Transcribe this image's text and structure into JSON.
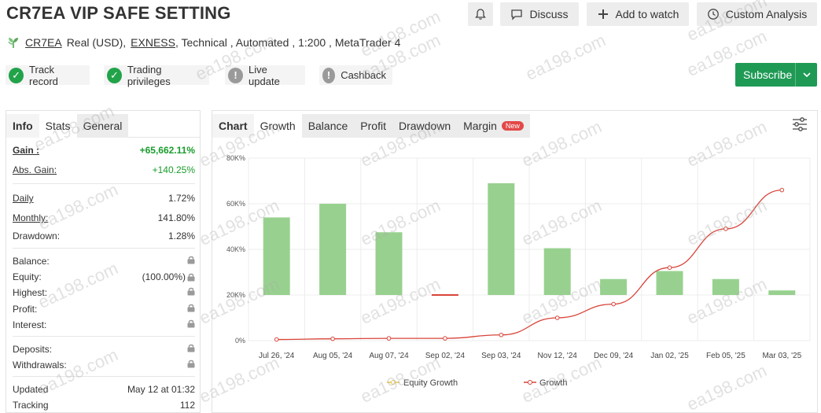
{
  "header": {
    "title": "CR7EA VIP SAFE SETTING",
    "account_name": "CR7EA",
    "account_type": "Real (USD),",
    "broker": "EXNESS",
    "details": ", Technical , Automated , 1:200 , MetaTrader 4"
  },
  "toolbar": {
    "discuss_label": "Discuss",
    "add_watch_label": "Add to watch",
    "custom_analysis_label": "Custom Analysis",
    "subscribe_label": "Subscribe"
  },
  "badges": {
    "track_record": "Track record",
    "trading_privileges": "Trading privileges",
    "live_update": "Live update",
    "cashback": "Cashback"
  },
  "left_tabs": {
    "info": "Info",
    "stats": "Stats",
    "general": "General"
  },
  "stats": {
    "gain_label": "Gain :",
    "gain_value": "+65,662.11%",
    "abs_gain_label": "Abs. Gain:",
    "abs_gain_value": "+140.25%",
    "daily_label": "Daily",
    "daily_value": "1.72%",
    "monthly_label": "Monthly:",
    "monthly_value": "141.80%",
    "drawdown_label": "Drawdown:",
    "drawdown_value": "1.28%",
    "balance_label": "Balance:",
    "equity_label": "Equity:",
    "equity_value": "(100.00%)",
    "highest_label": "Highest:",
    "profit_label": "Profit:",
    "interest_label": "Interest:",
    "deposits_label": "Deposits:",
    "withdrawals_label": "Withdrawals:",
    "updated_label": "Updated",
    "updated_value": "May 12 at 01:32",
    "tracking_label": "Tracking",
    "tracking_value": "112"
  },
  "chart_tabs": {
    "chart": "Chart",
    "growth": "Growth",
    "balance": "Balance",
    "profit": "Profit",
    "drawdown": "Drawdown",
    "margin": "Margin",
    "new_badge": "New"
  },
  "watermark_text": "ea198.com",
  "chart_data": {
    "type": "bar",
    "categories": [
      "Jul 26, '24",
      "Aug 05, '24",
      "Aug 07, '24",
      "Sep 02, '24",
      "Sep 03, '24",
      "Nov 12, '24",
      "Dec 09, '24",
      "Jan 02, '25",
      "Feb 05, '25",
      "Mar 03, '25"
    ],
    "y_tick_labels": [
      "0%",
      "20K%",
      "40K%",
      "60K%",
      "80K%"
    ],
    "ylim": [
      0,
      80000
    ],
    "bar_baseline": 20000,
    "series": [
      {
        "name": "Equity Growth",
        "type": "bar",
        "color": "#98d18f",
        "values": [
          54000,
          60000,
          47500,
          20000,
          69000,
          40500,
          27000,
          30500,
          27000,
          22000
        ]
      },
      {
        "name": "Growth",
        "type": "line",
        "color": "#d9443a",
        "values": [
          500,
          800,
          1000,
          1000,
          2500,
          10000,
          16000,
          32000,
          49000,
          66000
        ]
      }
    ],
    "grid": true,
    "legend": "bottom-center"
  },
  "colors": {
    "accent_green": "#1f9a55",
    "badge_green": "#22a34a",
    "gain_green": "#1a9c2c",
    "bar_green": "#98d18f",
    "line_red": "#d9443a",
    "new_red": "#e34848"
  }
}
